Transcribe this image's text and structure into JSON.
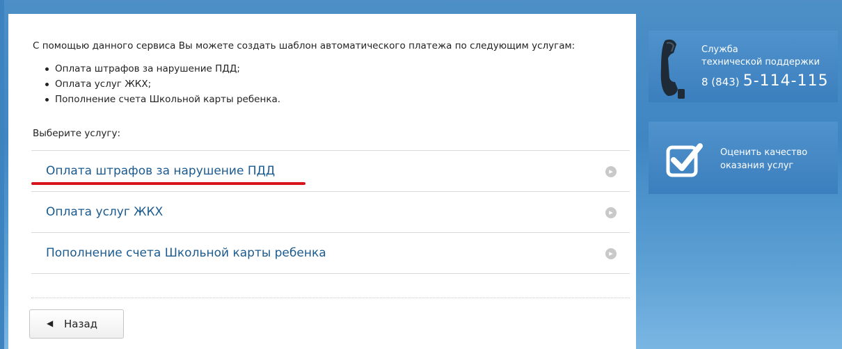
{
  "intro": {
    "text": "С помощью данного сервиса Вы можете создать шаблон автоматического платежа по следующим услугам:",
    "bullets": [
      "Оплата штрафов за нарушение ПДД;",
      "Оплата услуг ЖКХ;",
      "Пополнение счета Школьной карты ребенка."
    ]
  },
  "choose_label": "Выберите услугу:",
  "services": [
    {
      "label": "Оплата штрафов за нарушение ПДД",
      "highlighted": true
    },
    {
      "label": "Оплата услуг ЖКХ"
    },
    {
      "label": "Пополнение счета Школьной карты ребенка"
    }
  ],
  "back_button": {
    "label": "Назад",
    "icon": "chevron-left-icon"
  },
  "support": {
    "line1": "Служба",
    "line2": "технической поддержки",
    "code": "8 (843)",
    "number": "5-114-115",
    "icon": "phone-icon"
  },
  "quality": {
    "line1": "Оценить качество",
    "line2": "оказания услуг",
    "icon": "checkbox-check-icon"
  },
  "colors": {
    "accent": "#3f86c3",
    "link": "#1a5a8f",
    "highlight": "#d7141c"
  }
}
